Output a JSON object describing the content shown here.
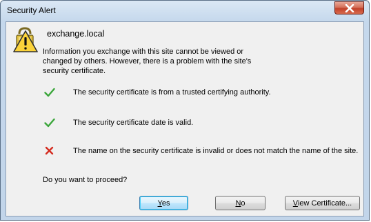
{
  "window": {
    "title": "Security Alert"
  },
  "dialog": {
    "host": "exchange.local",
    "intro": "Information you exchange with this site cannot be viewed or changed by others. However, there is a problem with the site's security certificate.",
    "checks": [
      {
        "status": "ok",
        "icon": "check-icon",
        "text": "The security certificate is from a trusted certifying authority."
      },
      {
        "status": "ok",
        "icon": "check-icon",
        "text": "The security certificate date is valid."
      },
      {
        "status": "error",
        "icon": "error-x-icon",
        "text": "The name on the security certificate is invalid or does not match the name of the site."
      }
    ],
    "question": "Do you want to proceed?"
  },
  "buttons": {
    "yes": {
      "mnemonic": "Y",
      "rest": "es"
    },
    "no": {
      "mnemonic": "N",
      "rest": "o"
    },
    "view": {
      "mnemonic": "V",
      "rest": "iew Certificate..."
    }
  },
  "colors": {
    "ok": "#3aa63a",
    "error": "#d42a1e"
  }
}
